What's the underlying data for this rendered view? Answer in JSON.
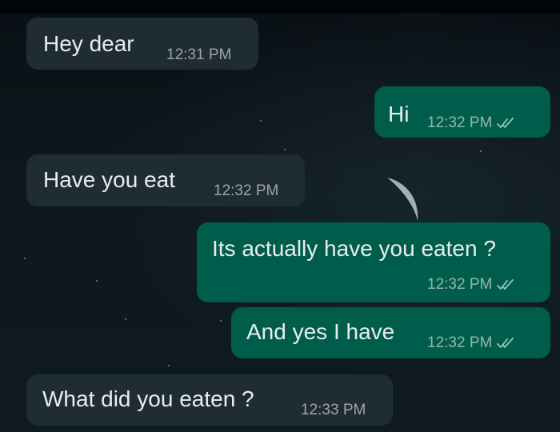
{
  "chat": {
    "messages": [
      {
        "direction": "incoming",
        "text": "Hey dear",
        "time": "12:31 PM"
      },
      {
        "direction": "outgoing",
        "text": "Hi",
        "time": "12:32 PM",
        "status": "read"
      },
      {
        "direction": "incoming",
        "text": "Have you eat",
        "time": "12:32 PM"
      },
      {
        "direction": "outgoing",
        "text": "Its actually have you eaten ?",
        "time": "12:32 PM",
        "status": "read"
      },
      {
        "direction": "outgoing",
        "text": "And yes I have",
        "time": "12:32 PM",
        "status": "read"
      },
      {
        "direction": "incoming",
        "text": "What did you eaten ?",
        "time": "12:33 PM"
      }
    ]
  },
  "colors": {
    "incoming_bubble": "#1f2c33",
    "outgoing_bubble": "#005c4b",
    "read_tick": "#9fc3bd"
  },
  "icons": {
    "read_status": "double-check-icon"
  }
}
